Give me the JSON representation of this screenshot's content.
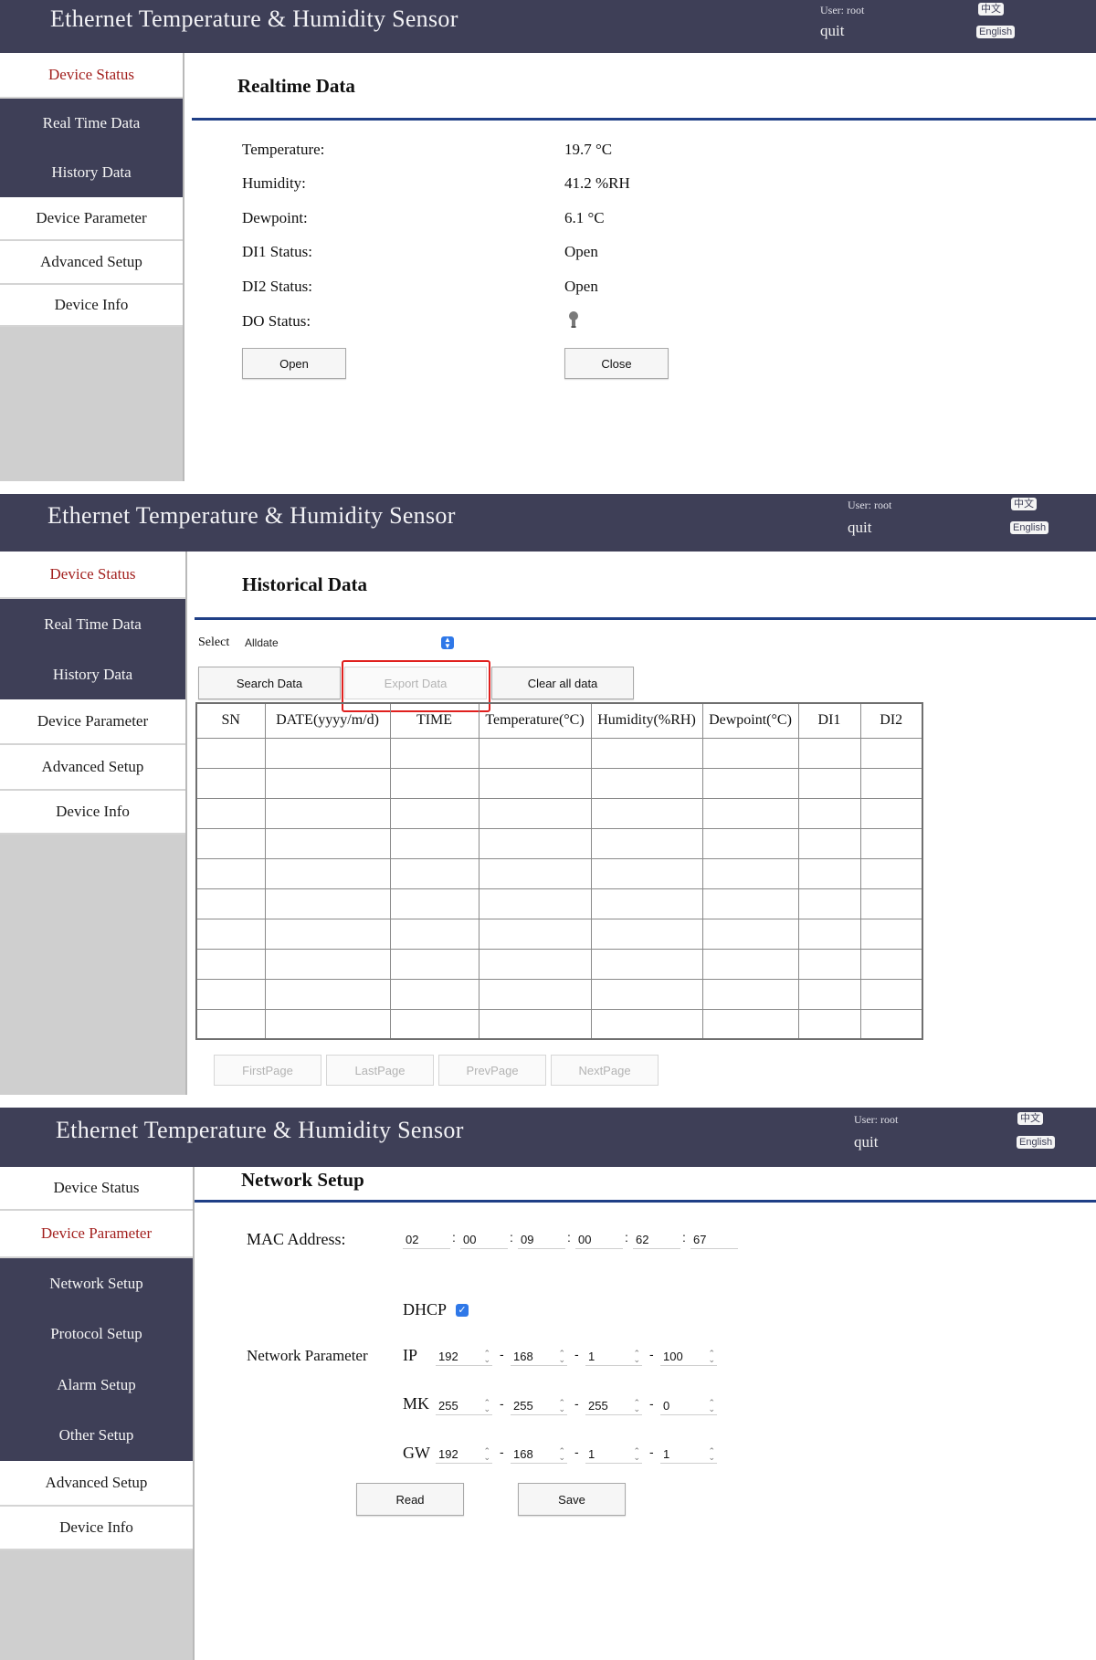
{
  "header": {
    "title": "Ethernet Temperature & Humidity Sensor",
    "user": "User: root",
    "quit": "quit",
    "lang_cn": "中文",
    "lang_en": "English"
  },
  "panel1": {
    "nav": [
      "Device Status",
      "Real Time Data",
      "History Data",
      "Device Parameter",
      "Advanced Setup",
      "Device Info"
    ],
    "section_title": "Realtime Data",
    "rows": [
      {
        "label": "Temperature:",
        "value": "19.7 °C"
      },
      {
        "label": "Humidity:",
        "value": "41.2 %RH"
      },
      {
        "label": "Dewpoint:",
        "value": "6.1 °C"
      },
      {
        "label": "DI1 Status:",
        "value": "Open"
      },
      {
        "label": "DI2 Status:",
        "value": "Open"
      },
      {
        "label": "DO Status:",
        "value": ""
      }
    ],
    "do_icon": "lightbulb-icon",
    "open_button": "Open",
    "close_button": "Close"
  },
  "panel2": {
    "nav": [
      "Device Status",
      "Real Time Data",
      "History Data",
      "Device Parameter",
      "Advanced Setup",
      "Device Info"
    ],
    "section_title": "Historical Data",
    "select_label": "Select",
    "select_value": "Alldate",
    "search_button": "Search Data",
    "export_button": "Export Data",
    "clear_button": "Clear all data",
    "columns": [
      "SN",
      "DATE(yyyy/m/d)",
      "TIME",
      "Temperature(°C)",
      "Humidity(%RH)",
      "Dewpoint(°C)",
      "DI1",
      "DI2"
    ],
    "empty_rows": 10,
    "pager": [
      "FirstPage",
      "LastPage",
      "PrevPage",
      "NextPage"
    ],
    "highlight_color": "#e0201e"
  },
  "panel3": {
    "nav": [
      "Device Status",
      "Device Parameter",
      "Network Setup",
      "Protocol Setup",
      "Alarm Setup",
      "Other Setup",
      "Advanced Setup",
      "Device Info"
    ],
    "section_title": "Network Setup",
    "mac_label": "MAC Address:",
    "mac": [
      "02",
      "00",
      "09",
      "00",
      "62",
      "67"
    ],
    "dhcp_label": "DHCP",
    "dhcp_checked": true,
    "network_label": "Network Parameter",
    "ip_label": "IP",
    "ip": [
      "192",
      "168",
      "1",
      "100"
    ],
    "mk_label": "MK",
    "mk": [
      "255",
      "255",
      "255",
      "0"
    ],
    "gw_label": "GW",
    "gw": [
      "192",
      "168",
      "1",
      "1"
    ],
    "read_button": "Read",
    "save_button": "Save"
  },
  "colors": {
    "header_bg": "#3e3f57",
    "active_nav": "#a3211f",
    "rule": "#1f3f86",
    "checkbox": "#2f78e8"
  }
}
